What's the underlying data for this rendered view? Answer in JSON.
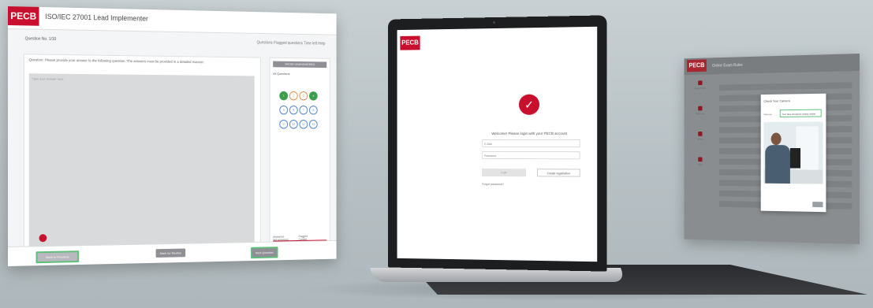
{
  "exam_panel": {
    "logo": "PECB",
    "title": "ISO/IEC 27001 Lead Implementer",
    "question_number": "Question No. 1/10",
    "header_links": "Questions   Flagged questions   Time left   Help",
    "question_text": "Question: Please provide your answer to the following question. The answers must be provided in a detailed manner.",
    "answer_placeholder": "Type your answer here",
    "navigator_button": "SHOW UNANSWERED",
    "all_questions_label": "All Questions",
    "questions": [
      {
        "n": "1",
        "state": "ans"
      },
      {
        "n": "2",
        "state": "flag"
      },
      {
        "n": "3",
        "state": "flag"
      },
      {
        "n": "4",
        "state": "ans"
      },
      {
        "n": "5",
        "state": ""
      },
      {
        "n": "6",
        "state": ""
      },
      {
        "n": "7",
        "state": ""
      },
      {
        "n": "8",
        "state": ""
      },
      {
        "n": "9",
        "state": ""
      },
      {
        "n": "10",
        "state": ""
      },
      {
        "n": "11",
        "state": ""
      },
      {
        "n": "12",
        "state": ""
      }
    ],
    "legend": [
      "Answered",
      "Flagged",
      "Not answered",
      "Current"
    ],
    "end_exam": "Submit Exam",
    "back_button": "Back to Previous",
    "review_button": "Mark for Review",
    "next_button": "Next Question"
  },
  "laptop": {
    "logo": "PECB",
    "emblem": "✓",
    "welcome": "Welcome! Please login with your PECB account",
    "email_placeholder": "E-Mail",
    "password_placeholder": "Password",
    "login_button": "Login",
    "register_button": "Create registration",
    "forgot": "Forgot password?"
  },
  "proctor_panel": {
    "logo": "PECB",
    "title": "Online Exam Rules",
    "nav": [
      "Exam Rules",
      "Webcam",
      "Identity",
      "Start"
    ],
    "modal_title": "Check Your Camera",
    "modal_label": "Webcam",
    "modal_hint": "Your face should be clearly visible"
  }
}
